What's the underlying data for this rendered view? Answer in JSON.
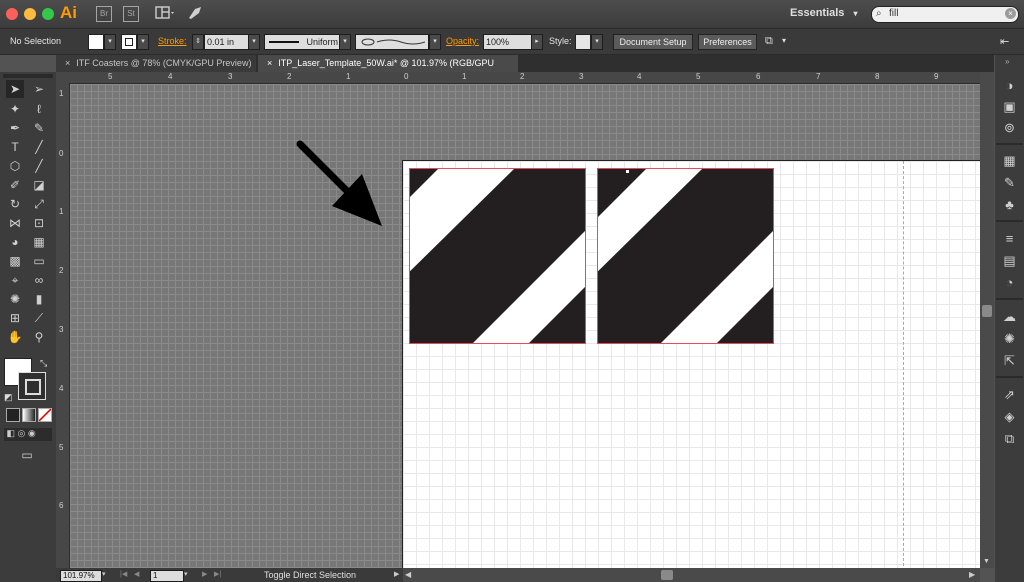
{
  "app": {
    "name": "Ai",
    "bridge_label": "Br",
    "stock_label": "St",
    "workspace": "Essentials"
  },
  "search": {
    "value": "fill"
  },
  "control_bar": {
    "selection": "No Selection",
    "stroke_label": "Stroke:",
    "stroke_value": "0.01 in",
    "stroke_profile": "Uniform",
    "opacity_label": "Opacity:",
    "opacity_value": "100%",
    "style_label": "Style:",
    "document_setup": "Document Setup",
    "preferences": "Preferences"
  },
  "tabs": [
    {
      "label": "ITF Coasters @ 78% (CMYK/GPU Preview)"
    },
    {
      "label": "ITP_Laser_Template_50W.ai* @ 101.97% (RGB/GPU Preview)"
    }
  ],
  "ruler_top_labels": [
    "5",
    "4",
    "3",
    "2",
    "1",
    "0",
    "1",
    "2",
    "3",
    "4",
    "5",
    "6",
    "7",
    "8",
    "9"
  ],
  "ruler_left_labels": [
    "1",
    "0",
    "1",
    "2",
    "3",
    "4",
    "5",
    "6"
  ],
  "status": {
    "zoom": "101.97%",
    "artboard": "1",
    "tool_hint": "Toggle Direct Selection"
  },
  "colors": {
    "accent": "#ff9a00",
    "coaster_fill": "#231f20",
    "artboard_outline": "#e64b5a",
    "canvas": "#777777"
  }
}
